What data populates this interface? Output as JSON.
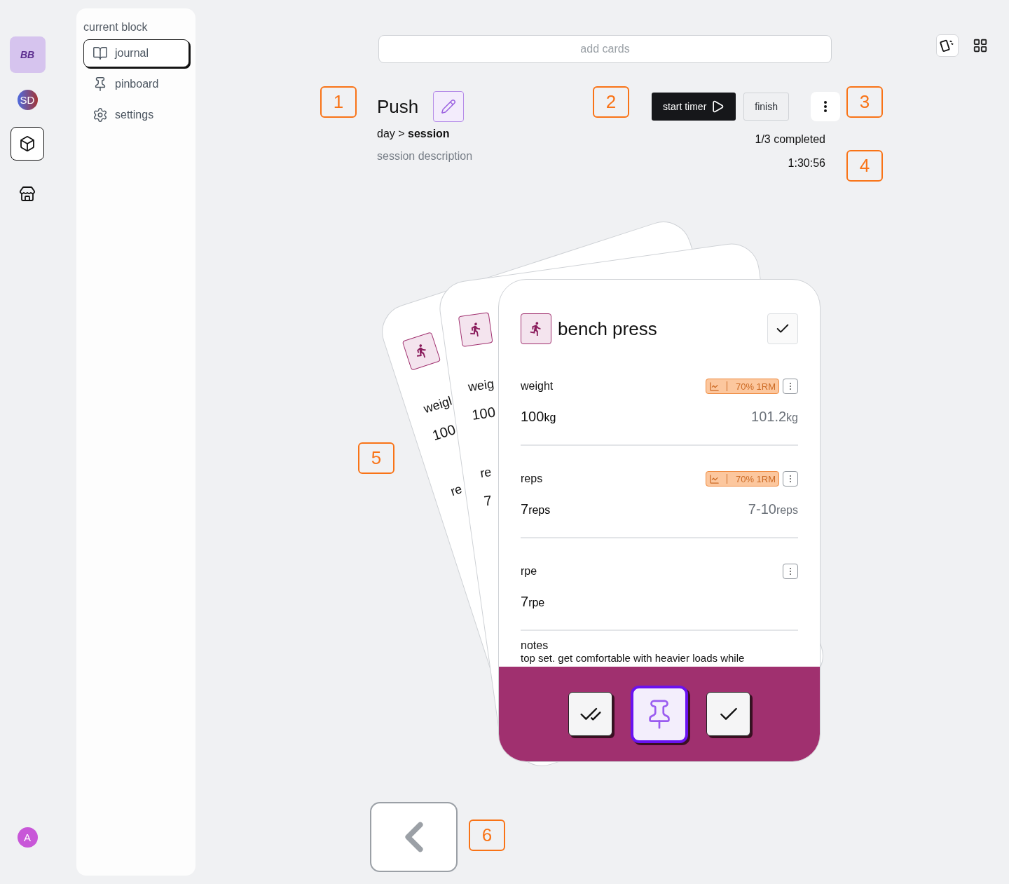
{
  "rail": {
    "logo": "BB",
    "items": [
      {
        "kind": "avatar",
        "label": "SD",
        "selected": false
      },
      {
        "kind": "blocks",
        "selected": true
      },
      {
        "kind": "store",
        "selected": false
      }
    ],
    "user": "A"
  },
  "sidebar": {
    "heading": "current block",
    "items": [
      {
        "label": "journal",
        "selected": true
      },
      {
        "label": "pinboard",
        "selected": false
      },
      {
        "label": "settings",
        "selected": false
      }
    ]
  },
  "search": {
    "placeholder": "add cards"
  },
  "view_toggle": [
    {
      "kind": "cards",
      "selected": true
    },
    {
      "kind": "grid",
      "selected": false
    }
  ],
  "session": {
    "title": "Push",
    "breadcrumb": "day > **session**",
    "description": "session description",
    "progress": "1/3 completed",
    "elapsed": "1:30:56",
    "start": "start timer",
    "finish": "finish"
  },
  "back_cards": [
    {
      "fields": [
        {
          "label": "weigl",
          "value": "100"
        },
        {
          "label": "re"
        }
      ]
    },
    {
      "fields": [
        {
          "label": "weig",
          "value": "100"
        },
        {
          "label": "re",
          "value": "7"
        }
      ]
    }
  ],
  "card": {
    "title": "bench press",
    "fields": [
      {
        "label": "weight",
        "badge": "70% 1RM",
        "value": "100",
        "unit": "kg",
        "target": "101.2",
        "target_unit": "kg"
      },
      {
        "label": "reps",
        "badge": "70% 1RM",
        "value": "7",
        "unit": "reps",
        "target": "7-10",
        "target_unit": "reps"
      },
      {
        "label": "rpe",
        "value": "7",
        "unit": "rpe"
      }
    ],
    "notes_label": "notes",
    "notes": "top set. get comfortable with heavier loads while",
    "actions": [
      {
        "kind": "complete-all",
        "selected": false
      },
      {
        "kind": "pin",
        "selected": true
      },
      {
        "kind": "complete",
        "selected": false
      }
    ]
  },
  "annotations": [
    "1",
    "2",
    "3",
    "4",
    "5",
    "6"
  ]
}
